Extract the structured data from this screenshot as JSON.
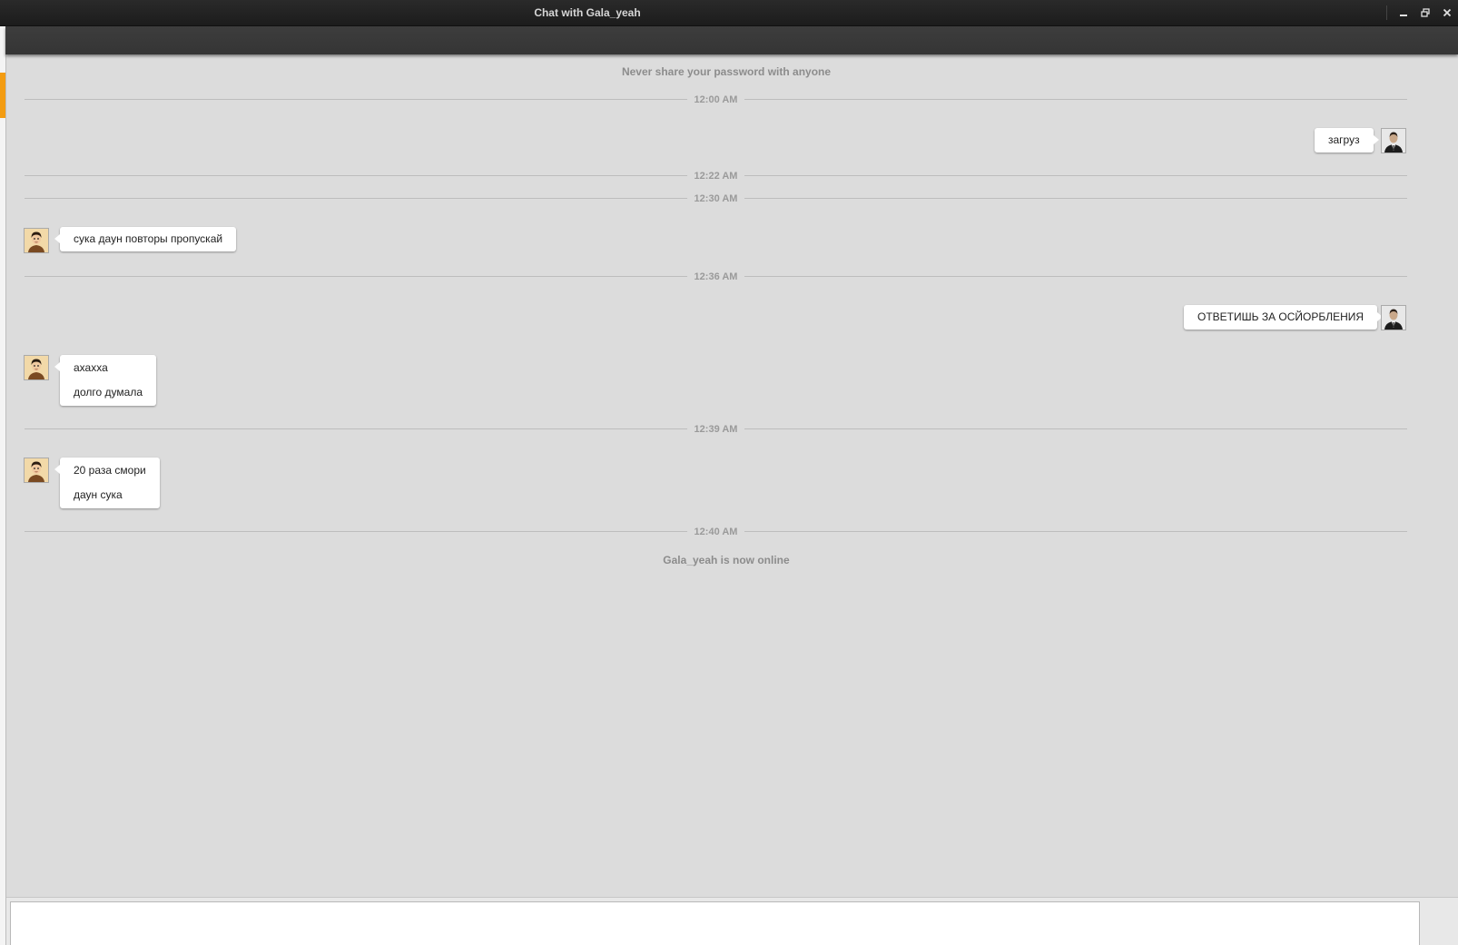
{
  "window": {
    "title": "Chat with Gala_yeah",
    "controls": [
      "minimize-icon",
      "restore-icon",
      "close-icon"
    ]
  },
  "chat": {
    "security_notice": "Never share your password with anyone",
    "status_notice": "Gala_yeah is now online",
    "separators": [
      "12:00 AM",
      "12:22 AM",
      "12:30 AM",
      "12:36 AM",
      "12:39 AM",
      "12:40 AM"
    ],
    "messages": [
      {
        "direction": "outgoing",
        "lines": [
          "загруз"
        ]
      },
      {
        "direction": "incoming",
        "lines": [
          "сука даун повторы пропускай"
        ]
      },
      {
        "direction": "outgoing",
        "lines": [
          "ОТВЕТИШЬ ЗА ОСЙОРБЛЕНИЯ"
        ]
      },
      {
        "direction": "incoming",
        "lines": [
          "ахахха",
          "долго думала"
        ]
      },
      {
        "direction": "incoming",
        "lines": [
          "20 раза смори",
          "даун сука"
        ]
      }
    ]
  },
  "input": {
    "value": ""
  },
  "colors": {
    "background": "#dcdcdc",
    "titlebar": "#1c1c1c",
    "toolbar": "#3a3a3a",
    "accent": "#f39c12",
    "bubble": "#ffffff"
  }
}
